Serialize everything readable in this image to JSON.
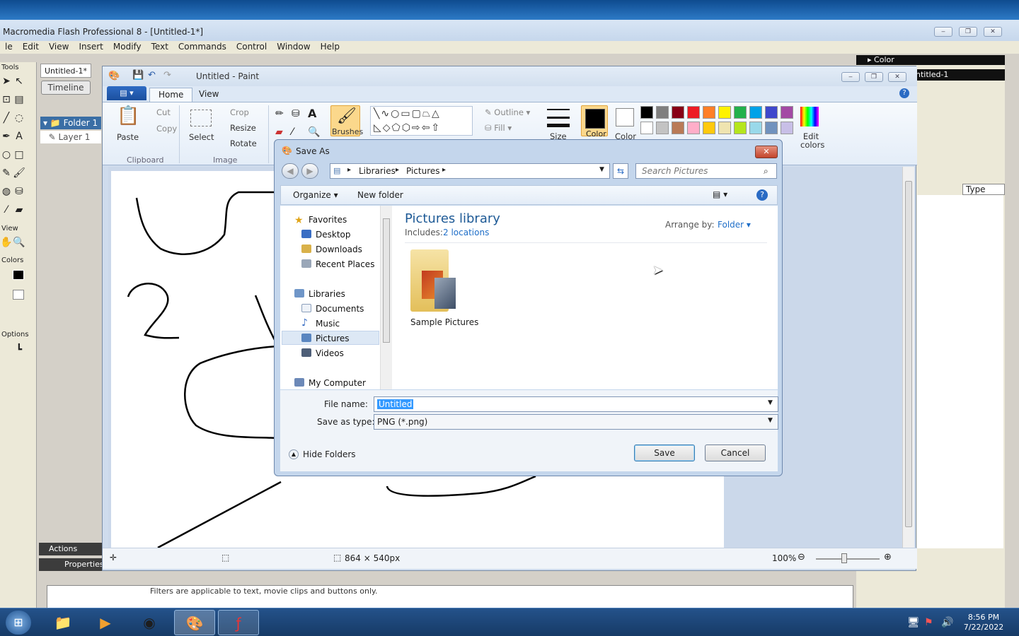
{
  "flash": {
    "title": "Macromedia Flash Professional 8 - [Untitled-1*]",
    "menu": [
      "le",
      "Edit",
      "View",
      "Insert",
      "Modify",
      "Text",
      "Commands",
      "Control",
      "Window",
      "Help"
    ],
    "tools_label": "Tools",
    "view_label": "View",
    "colors_label": "Colors",
    "options_label": "Options",
    "doc_tab": "Untitled-1*",
    "timeline_button": "Timeline",
    "folder_layer": "Folder 1",
    "layer": "Layer 1",
    "panel_actions": "Actions",
    "panel_properties": "Properties",
    "filter_note": "Filters are applicable to text, movie clips and buttons only.",
    "right_color_panel": "Color",
    "right_doc_title": "ntitled-1",
    "right_type_header": "Type"
  },
  "paint": {
    "title": "Untitled - Paint",
    "tabs": [
      "Home",
      "View"
    ],
    "clipboard": {
      "paste": "Paste",
      "cut": "Cut",
      "copy": "Copy",
      "group": "Clipboard"
    },
    "image": {
      "select": "Select",
      "crop": "Crop",
      "resize": "Resize",
      "rotate": "Rotate",
      "group": "Image"
    },
    "brushes": "Brushes",
    "shapes": {
      "outline": "Outline",
      "fill": "Fill"
    },
    "size": "Size",
    "color1": "Color",
    "color2": "Color",
    "edit_colors": "Edit colors",
    "palette": [
      "#000000",
      "#7f7f7f",
      "#880015",
      "#ed1c24",
      "#ff7f27",
      "#fff200",
      "#22b14c",
      "#00a2e8",
      "#3f48cc",
      "#a349a4",
      "#ffffff",
      "#c3c3c3",
      "#b97a57",
      "#ffaec9",
      "#ffc90e",
      "#efe4b0",
      "#b5e61d",
      "#99d9ea",
      "#7092be",
      "#c8bfe7"
    ],
    "status_dimensions": "864 × 540px",
    "zoom": "100%"
  },
  "dialog": {
    "title": "Save As",
    "breadcrumb": [
      "Libraries",
      "Pictures"
    ],
    "search_placeholder": "Search Pictures",
    "organize": "Organize",
    "new_folder": "New folder",
    "nav_items": [
      "Favorites",
      "Desktop",
      "Downloads",
      "Recent Places",
      "Libraries",
      "Documents",
      "Music",
      "Pictures",
      "Videos",
      "My Computer"
    ],
    "library_title": "Pictures library",
    "includes_label": "Includes:",
    "includes_link": "2 locations",
    "arrange_label": "Arrange by:",
    "arrange_value": "Folder",
    "folder_item": "Sample Pictures",
    "file_name_label": "File name:",
    "file_name_value": "Untitled",
    "save_type_label": "Save as type:",
    "save_type_value": "PNG (*.png)",
    "hide_folders": "Hide Folders",
    "save_button": "Save",
    "cancel_button": "Cancel"
  },
  "taskbar": {
    "time": "8:56 PM",
    "date": "7/22/2022"
  }
}
